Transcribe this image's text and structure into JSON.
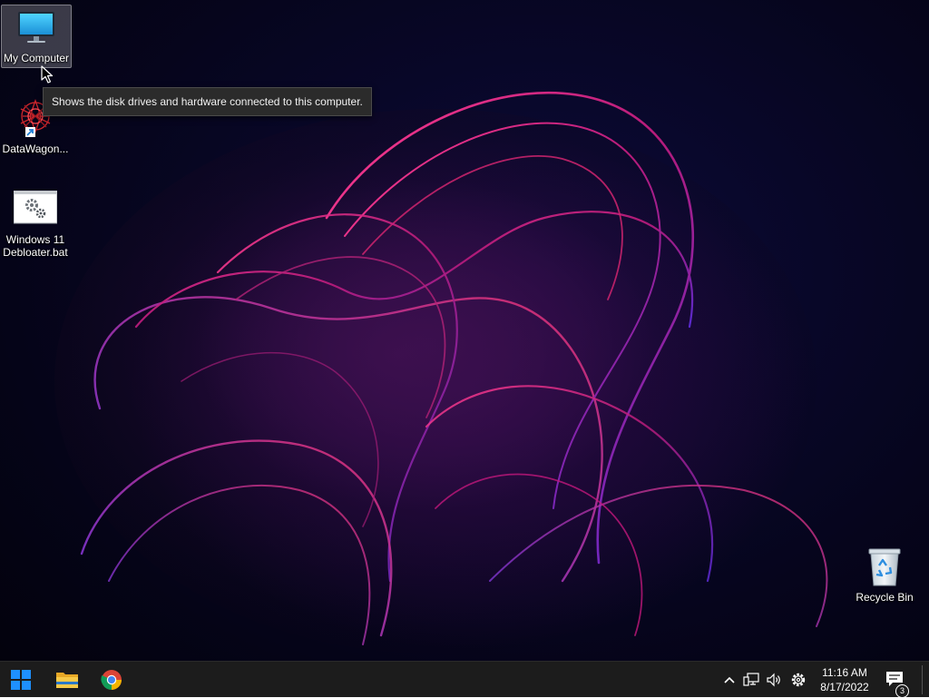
{
  "desktop": {
    "icons": [
      {
        "name": "my-computer",
        "label": "My Computer",
        "icon": "monitor-icon",
        "selected": true
      },
      {
        "name": "datawagon",
        "label": "DataWagon...",
        "icon": "datawagon-shortcut-icon",
        "selected": false
      },
      {
        "name": "debloater",
        "label": "Windows 11\nDebloater.bat",
        "icon": "batch-file-gear-icon",
        "selected": false
      },
      {
        "name": "recycle-bin",
        "label": "Recycle Bin",
        "icon": "recycle-bin-icon",
        "selected": false
      }
    ],
    "tooltip": "Shows the disk drives and hardware connected to this computer."
  },
  "taskbar": {
    "pinned": [
      {
        "name": "start",
        "icon": "windows-logo-icon"
      },
      {
        "name": "file-explorer",
        "icon": "folder-icon"
      },
      {
        "name": "chrome",
        "icon": "chrome-icon"
      }
    ],
    "tray": {
      "icons": [
        "chevron-up-icon",
        "network-icon",
        "volume-icon",
        "gear-icon"
      ],
      "time": "11:16 AM",
      "date": "8/17/2022",
      "notifications_count": "3"
    }
  },
  "colors": {
    "taskbar_bg": "#1c1c1c",
    "windows_blue": "#1e90ff",
    "wallpaper_magenta": "#c2187c",
    "wallpaper_violet": "#5b2bd6"
  }
}
